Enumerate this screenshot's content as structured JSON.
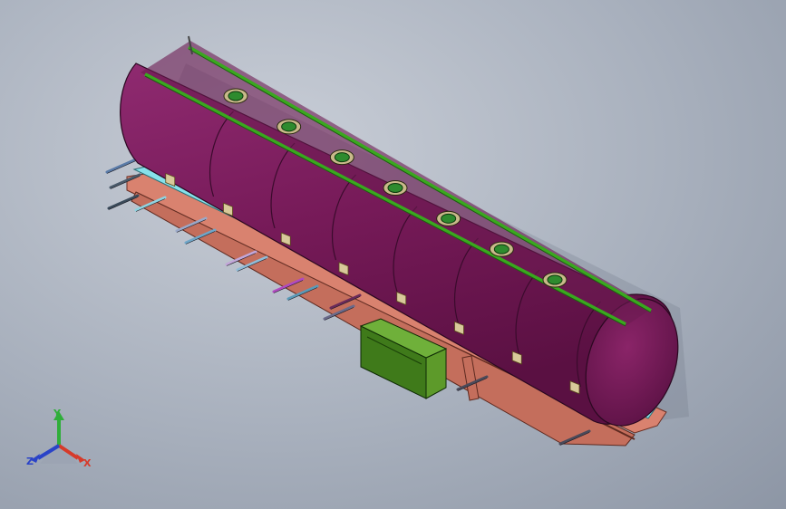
{
  "viewport": {
    "background_colors": [
      "#c9ced7",
      "#8d96a5"
    ]
  },
  "model": {
    "tank_color": "#7a1f5c",
    "rail_color": "#3aa81f",
    "chassis_color": "#d9826f",
    "toolbox_color": "#3f7a1a",
    "hatch_color": "#2e8b2e",
    "hatch_count": 7,
    "tank_segments": 8
  },
  "triad": {
    "y_label": "Y",
    "z_label": "Z",
    "x_label": "X",
    "y_color": "#2fae3a",
    "z_color": "#2a43c8",
    "x_color": "#d63a2a"
  }
}
